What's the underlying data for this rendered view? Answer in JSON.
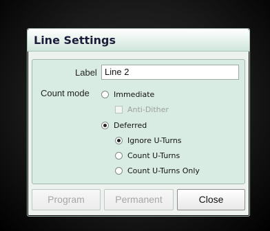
{
  "dialog": {
    "title": "Line Settings",
    "label_caption": "Label",
    "label_value": "Line 2",
    "count_mode_caption": "Count mode",
    "options": {
      "immediate": "Immediate",
      "anti_dither": "Anti-Dither",
      "deferred": "Deferred",
      "ignore_uturns": "Ignore U-Turns",
      "count_uturns": "Count U-Turns",
      "count_uturns_only": "Count U-Turns Only"
    },
    "selected_count_mode": "Deferred",
    "selected_deferred_option": "Ignore U-Turns",
    "anti_dither_checked": false,
    "anti_dither_enabled": false
  },
  "buttons": {
    "program": "Program",
    "permanent": "Permanent",
    "close": "Close"
  }
}
